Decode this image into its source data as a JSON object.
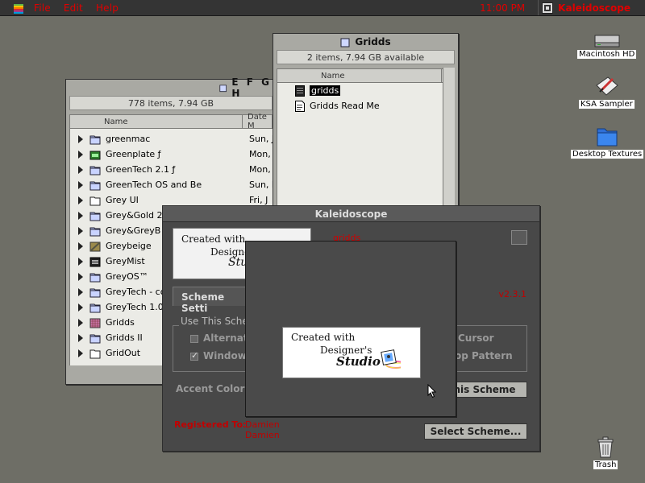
{
  "menubar": {
    "menus": [
      "File",
      "Edit",
      "Help"
    ],
    "clock": "11:00 PM",
    "app_name": "Kaleidoscope",
    "accent_color": "#e00000"
  },
  "efgh_window": {
    "title": "E F G H",
    "info": "778 items, 7.94 GB",
    "col_name": "Name",
    "col_date": "Date M",
    "rows": [
      {
        "name": "greenmac",
        "date": "Sun, J",
        "icon": "folder-icon"
      },
      {
        "name": "Greenplate ƒ",
        "date": "Mon, C",
        "icon": "app-folder-icon"
      },
      {
        "name": "GreenTech 2.1 ƒ",
        "date": "Mon, S",
        "icon": "folder-icon"
      },
      {
        "name": "GreenTech OS and Be",
        "date": "Sun, M",
        "icon": "folder-icon"
      },
      {
        "name": "Grey UI",
        "date": "Fri, J",
        "icon": "folder-outline-icon"
      },
      {
        "name": "Grey&Gold 2.1",
        "date": "",
        "icon": "folder-icon"
      },
      {
        "name": "Grey&GreyB",
        "date": "",
        "icon": "folder-icon"
      },
      {
        "name": "Greybeige",
        "date": "",
        "icon": "stripe-folder-icon"
      },
      {
        "name": "GreyMist",
        "date": "",
        "icon": "mist-folder-icon"
      },
      {
        "name": "GreyOS™",
        "date": "",
        "icon": "folder-icon"
      },
      {
        "name": "GreyTech - col",
        "date": "",
        "icon": "folder-icon"
      },
      {
        "name": "GreyTech 1.0",
        "date": "",
        "icon": "folder-icon"
      },
      {
        "name": "Gridds",
        "date": "",
        "icon": "grid-folder-icon"
      },
      {
        "name": "Gridds II",
        "date": "",
        "icon": "folder-icon"
      },
      {
        "name": "GridOut",
        "date": "",
        "icon": "folder-outline-icon"
      }
    ]
  },
  "gridds_window": {
    "title": "Gridds",
    "info": "2 items, 7.94 GB available",
    "col_name": "Name",
    "rows": [
      {
        "name": "gridds",
        "selected": true,
        "icon": "scheme-file-icon"
      },
      {
        "name": "Gridds Read Me",
        "selected": false,
        "icon": "document-icon"
      }
    ]
  },
  "kaleidoscope_window": {
    "title": "Kaleidoscope",
    "logo_line1": "Created with",
    "logo_line2": "Designer's",
    "logo_line3": "Studio",
    "scheme_name": "gridds",
    "version": "v2.3.1",
    "tab_label": "Scheme Setti",
    "group_label": "Use This Sche",
    "opt_alternate": "Alternat",
    "opt_windows": "Windows",
    "opt_cursor": "Cursor",
    "opt_pattern": "op Pattern",
    "accent_label": "Accent Color:",
    "use_scheme_btn": "his Scheme",
    "select_scheme_btn": "Select Scheme...",
    "registered_label": "Registered To:",
    "registered_name1": "Damien",
    "registered_name2": "Damien"
  },
  "about_popup": {
    "line1": "Created with",
    "line2": "Designer's",
    "line3": "Studio"
  },
  "desktop": {
    "icons": [
      {
        "label": "Macintosh HD"
      },
      {
        "label": "KSA Sampler"
      },
      {
        "label": "Desktop Textures"
      },
      {
        "label": "Trash"
      }
    ]
  }
}
